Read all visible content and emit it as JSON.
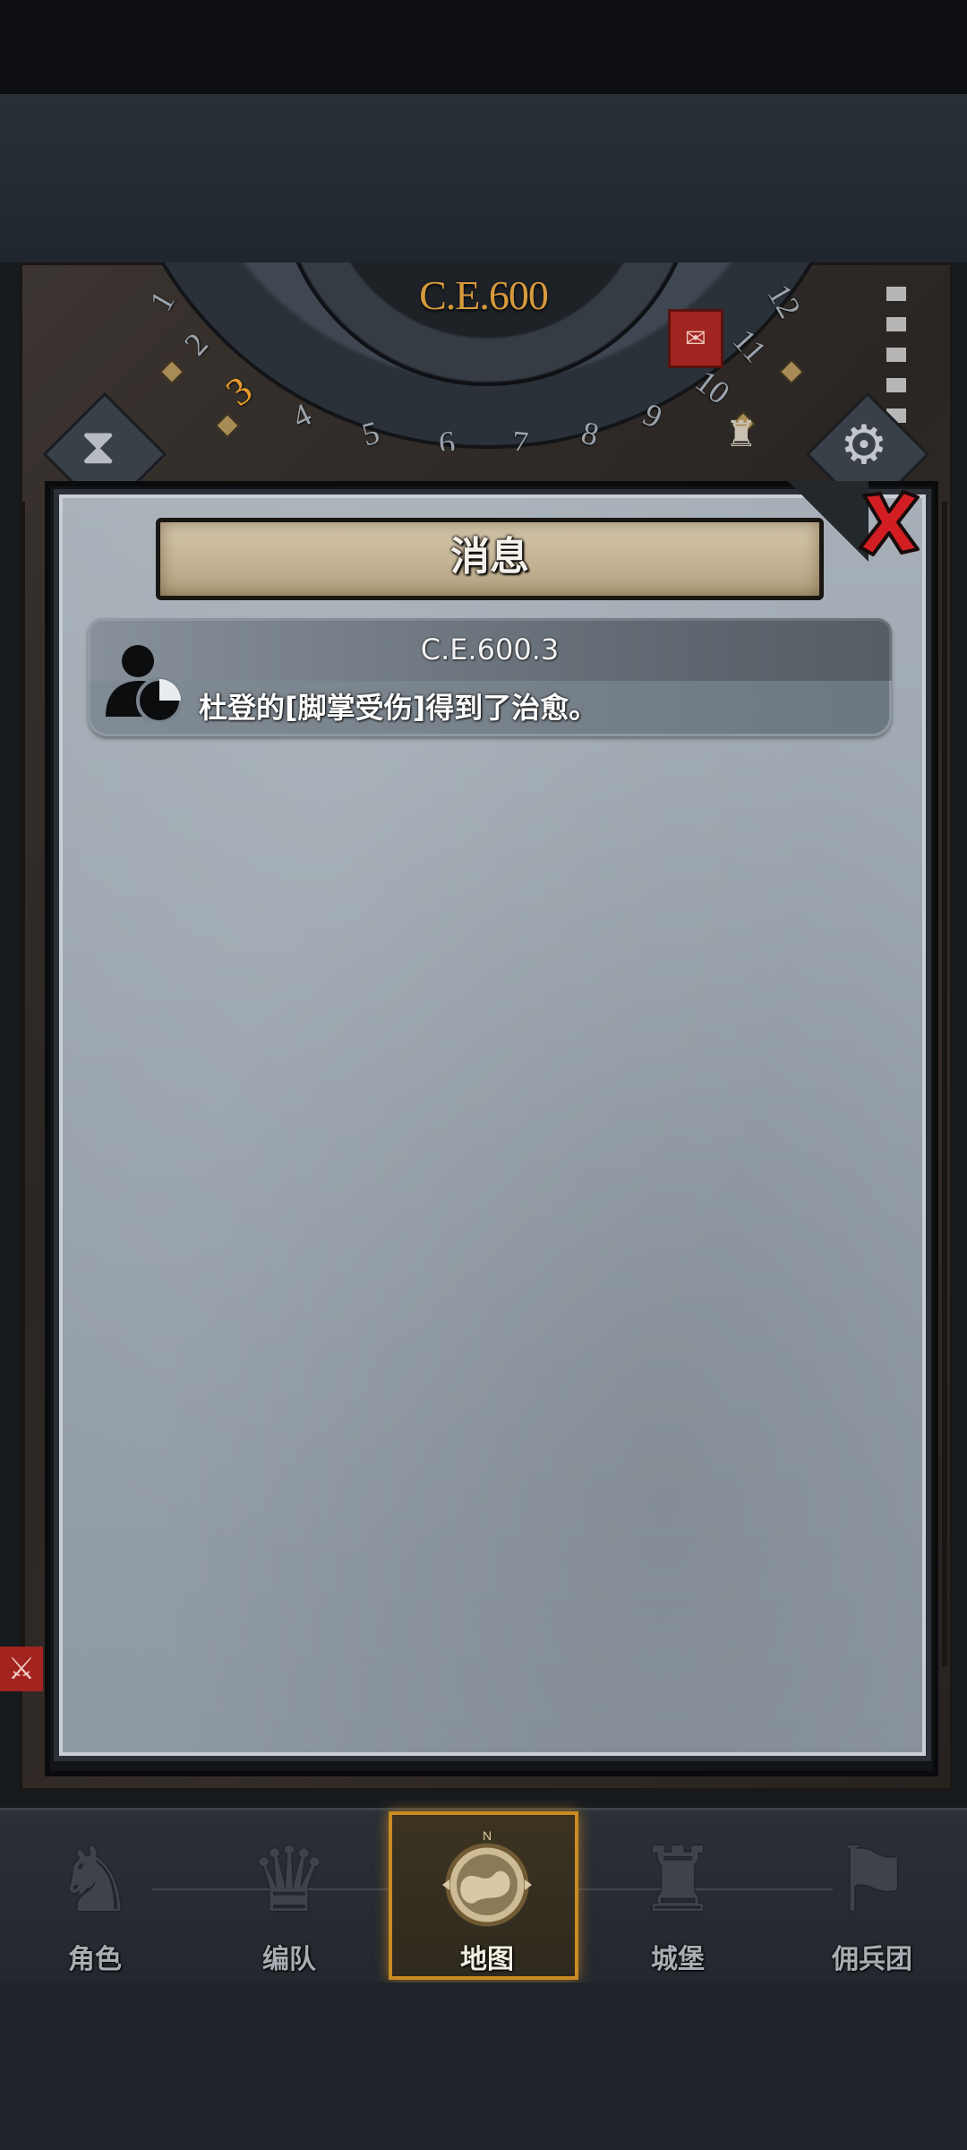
{
  "dial": {
    "year": "C.E.600",
    "months": [
      "1",
      "2",
      "3",
      "4",
      "5",
      "6",
      "7",
      "8",
      "9",
      "10",
      "11",
      "12"
    ],
    "active_month": "3"
  },
  "modal": {
    "title": "消息",
    "messages": [
      {
        "date": "C.E.600.3",
        "text": "杜登的[脚掌受伤]得到了治愈。",
        "icon": "person-icon"
      }
    ]
  },
  "nav": {
    "items": [
      {
        "label": "角色",
        "icon": "knight-icon"
      },
      {
        "label": "编队",
        "icon": "squad-icon"
      },
      {
        "label": "地图",
        "icon": "compass-map-icon",
        "active": true
      },
      {
        "label": "城堡",
        "icon": "castle-icon"
      },
      {
        "label": "佣兵团",
        "icon": "mercenary-icon"
      }
    ]
  },
  "colors": {
    "accent": "#c98b23",
    "year_text": "#d79a3c",
    "close_red": "#d21e22"
  }
}
